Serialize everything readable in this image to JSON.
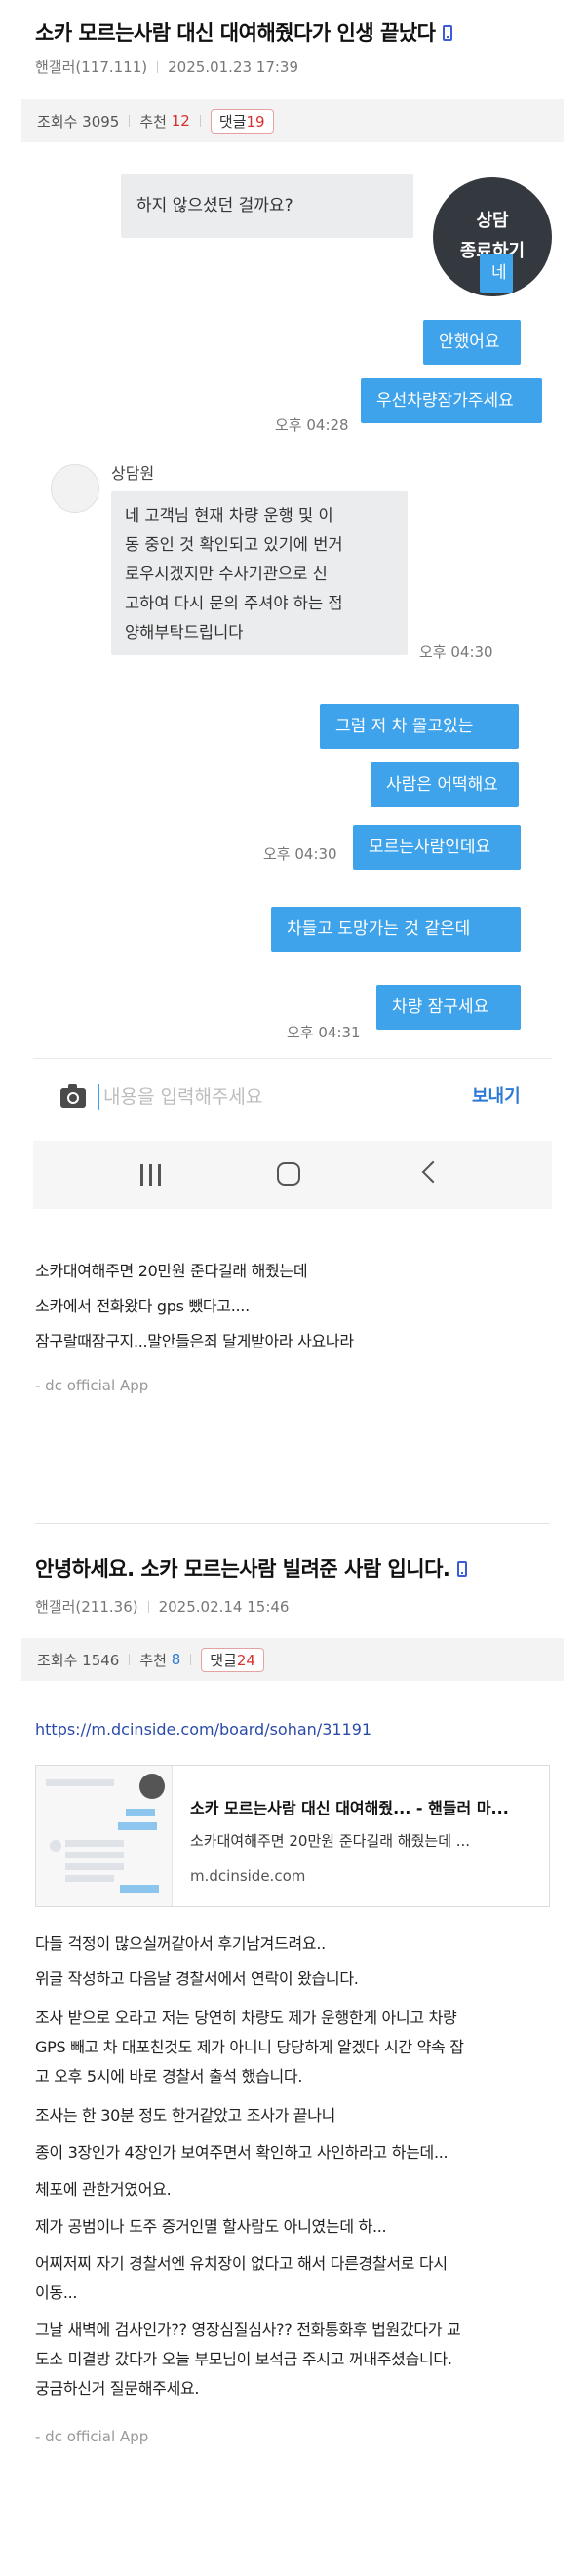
{
  "post1": {
    "title": "소카 모르는사람 대신 대여해줬다가 인생 끝났다",
    "author": "핸갤러(117.111)",
    "date": "2025.01.23 17:39",
    "views_label": "조회수 3095",
    "recommend_label": "추천",
    "recommend_count": "12",
    "comments_label": "댓글",
    "comments_count": "19",
    "chat": {
      "top_message": "하지 않으셨던 걸까요?",
      "end_button_line1": "상담",
      "end_button_line2": "종료하기",
      "user_msg_a": "네",
      "user_msg_b": "안했어요",
      "user_msg_c": "우선차량잠가주세요",
      "time_1": "오후 04:28",
      "agent_name": "상담원",
      "agent_message": "네 고객님 현재 차량 운행 및 이동 중인 것 확인되고 있기에 번거로우시겠지만 수사기관으로 신고하여 다시 문의 주셔야 하는 점 양해부탁드립니다",
      "agent_line1": "네 고객님 현재 차량 운행 및 이",
      "agent_line2": "동 중인 것 확인되고 있기에 번거",
      "agent_line3": "로우시겠지만 수사기관으로 신",
      "agent_line4": "고하여 다시 문의 주셔야 하는 점",
      "agent_line5": "양해부탁드립니다",
      "time_2": "오후 04:30",
      "user_msg_d": "그럼 저 차 몰고있는",
      "user_msg_e": "사람은 어떡해요",
      "time_3": "오후 04:30",
      "user_msg_f": "모르는사람인데요",
      "user_msg_g": "차들고 도망가는 것 같은데",
      "user_msg_h": "차량 잠구세요",
      "time_4": "오후 04:31",
      "input_placeholder": "내용을 입력해주세요",
      "send_label": "보내기"
    },
    "body_lines": [
      "소카대여해주면 20만원 준다길래 해줬는데",
      "소카에서 전화왔다 gps 뺐다고....",
      "잠구랄때잠구지...말안들은죄 달게받아라 사요나라"
    ],
    "app_tag": "- dc official App"
  },
  "post2": {
    "title": "안녕하세요. 소카 모르는사람 빌려준 사람 입니다.",
    "author": "핸갤러(211.36)",
    "date": "2025.02.14 15:46",
    "views_label": "조회수 1546",
    "recommend_label": "추천",
    "recommend_count": "8",
    "comments_label": "댓글",
    "comments_count": "24",
    "link_url": "https://m.dcinside.com/board/sohan/31191",
    "card": {
      "title": "소카 모르는사람 대신 대여해줬... - 핸들러 마...",
      "desc": "소카대여해주면 20만원 준다길래 해줬는데 ...",
      "domain": "m.dcinside.com",
      "thumb_badge_line1": "상담",
      "thumb_badge_line2": "종료하기"
    },
    "body_lines": [
      "다들 걱정이 많으실꺼같아서 후기남겨드려요..",
      "위글 작성하고 다음날 경찰서에서 연락이 왔습니다.",
      "조사 받으로 오라고 저는 당연히 차량도 제가 운행한게 아니고 차량",
      "GPS 빼고 차 대포친것도 제가 아니니 당당하게 알겠다 시간 약속 잡",
      "고 오후 5시에 바로 경찰서 출석 했습니다.",
      "조사는 한 30분 정도 한거같았고 조사가 끝나니",
      "종이 3장인가 4장인가  보여주면서 확인하고 사인하라고 하는데...",
      "체포에 관한거였어요.",
      "제가 공범이나 도주 증거인멸 할사람도 아니였는데 하...",
      "어찌저찌 자기 경찰서엔 유치장이 없다고 해서 다른경찰서로 다시",
      "이동...",
      "그날 새벽에 검사인가?? 영장심질심사?? 전화통화후 법원갔다가 교",
      "도소 미결방 갔다가 오늘 부모님이 보석금 주시고 꺼내주셨습니다.",
      "궁금하신거 질문해주세요."
    ],
    "app_tag": "- dc official App"
  }
}
